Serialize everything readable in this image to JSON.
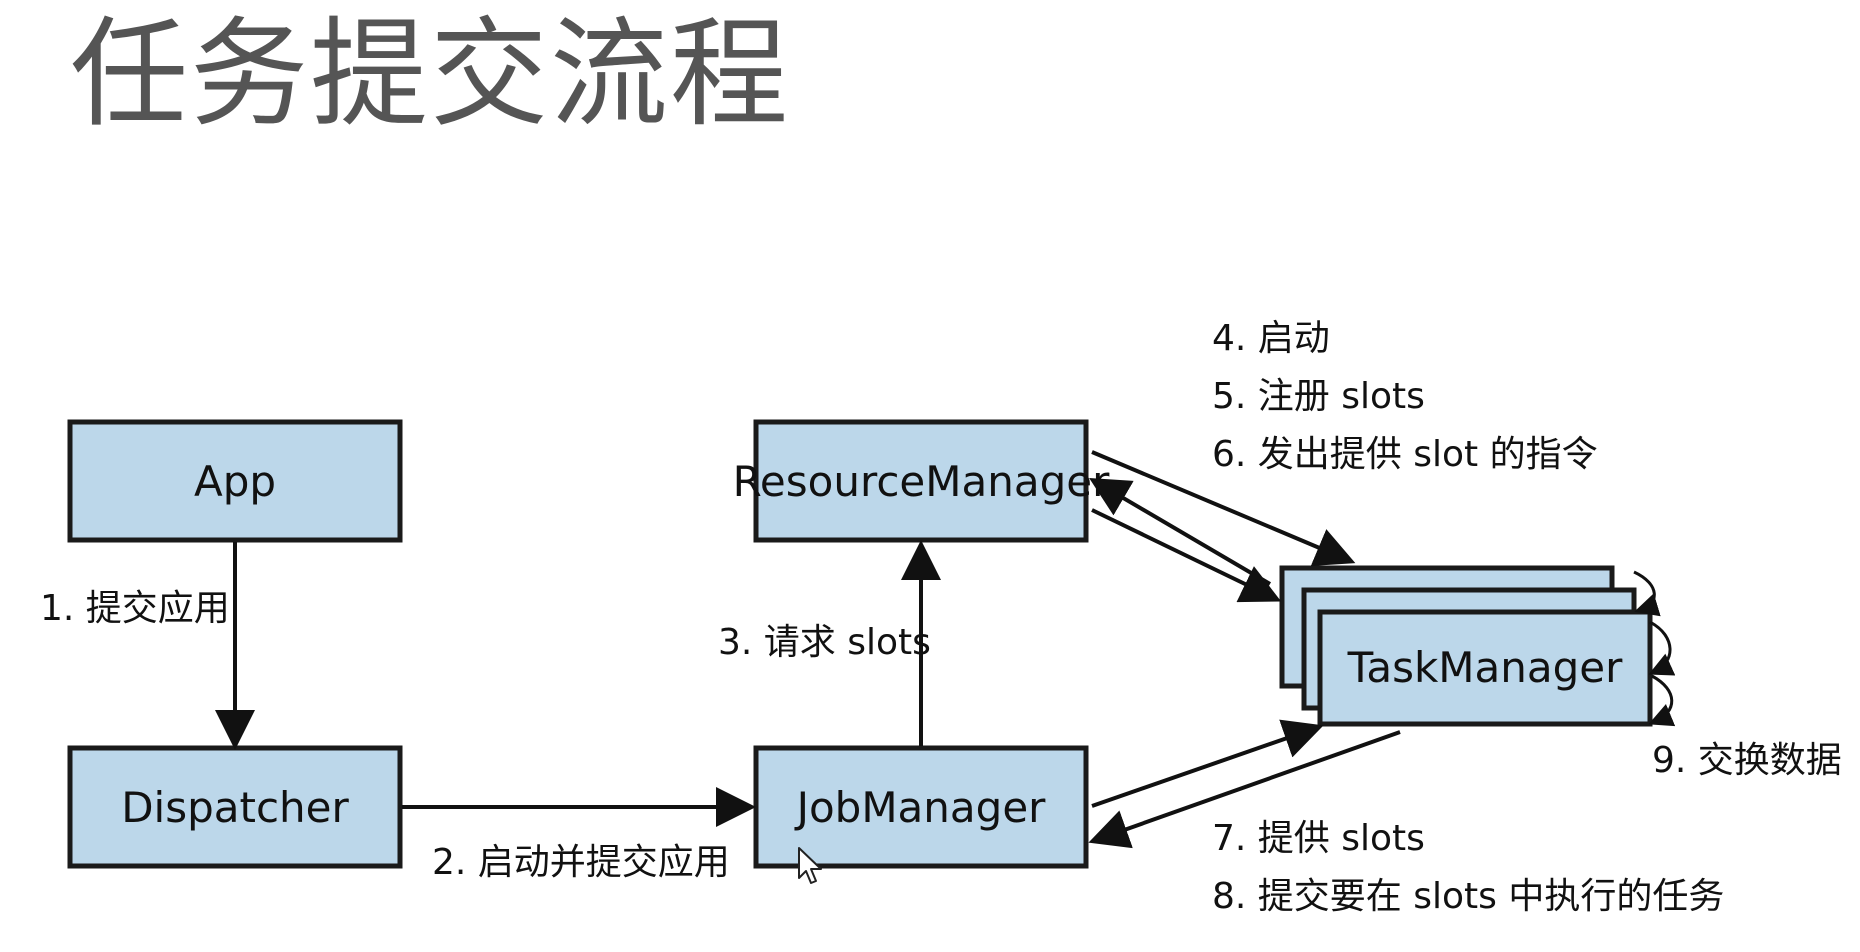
{
  "title": "任务提交流程",
  "boxes": {
    "app": "App",
    "dispatcher": "Dispatcher",
    "resource_manager": "ResourceManager",
    "job_manager": "JobManager",
    "task_manager": "TaskManager"
  },
  "steps": {
    "s1": "1. 提交应用",
    "s2": "2. 启动并提交应用",
    "s3": "3. 请求 slots",
    "s4": "4. 启动",
    "s5": "5. 注册 slots",
    "s6": "6. 发出提供 slot 的指令",
    "s7": "7. 提供 slots",
    "s8": "8. 提交要在 slots 中执行的任务",
    "s9": "9. 交换数据"
  },
  "colors": {
    "box_fill": "#bcd7ea",
    "box_stroke": "#1a1a1a",
    "title_text": "#555555"
  }
}
